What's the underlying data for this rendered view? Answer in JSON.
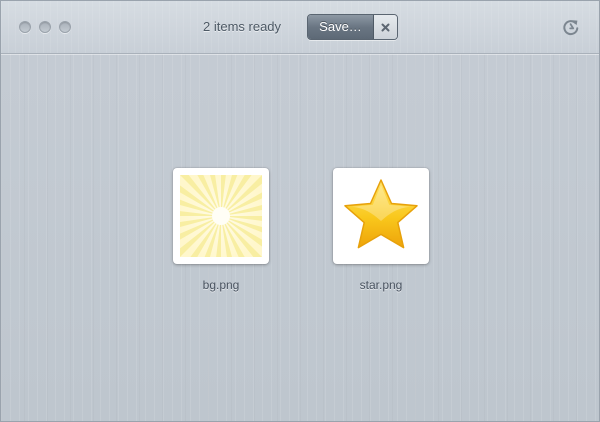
{
  "toolbar": {
    "status_text": "2 items ready",
    "save_label": "Save…",
    "cancel_icon": "close-icon",
    "reload_icon": "reload-icon"
  },
  "window_controls": [
    "close",
    "minimize",
    "zoom"
  ],
  "files": [
    {
      "name": "bg.png",
      "thumbnail": "sunburst-icon"
    },
    {
      "name": "star.png",
      "thumbnail": "star-icon"
    }
  ],
  "colors": {
    "save_button": "#6a7683",
    "background": "#c2cad2",
    "star_fill": "#f7c21b",
    "sunburst": "#fbf3b8"
  }
}
